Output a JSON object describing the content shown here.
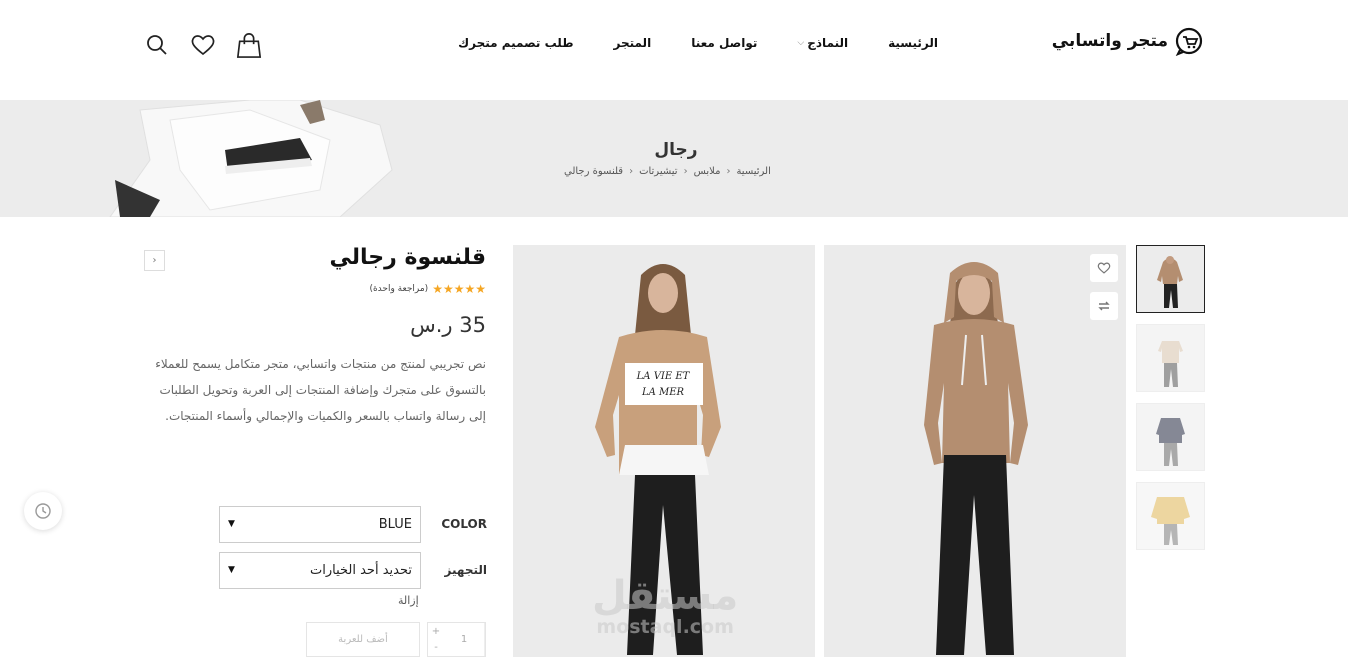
{
  "header": {
    "logo_text": "متجر واتسابي",
    "nav": [
      {
        "label": "الرئيسية"
      },
      {
        "label": "النماذج",
        "has_dropdown": true
      },
      {
        "label": "تواصل معنا"
      },
      {
        "label": "المتجر"
      },
      {
        "label": "طلب تصميم متجرك"
      }
    ],
    "icons": [
      "search-icon",
      "heart-icon",
      "shopping-bag-icon"
    ]
  },
  "banner": {
    "title": "رجال",
    "breadcrumb": [
      "الرئيسية",
      "ملابس",
      "تيشيرتات",
      "قلنسوة رجالي"
    ]
  },
  "product": {
    "title": "قلنسوة رجالي",
    "stars": "★★★★★",
    "reviews": "(مراجعة واحدة)",
    "price": "35 ر.س",
    "description": "نص تجريبي لمنتج من منتجات واتسابي، متجر متكامل يسمح للعملاء بالتسوق على متجرك وإضافة المنتجات إلى العربة وتحويل الطلبات إلى رسالة واتساب بالسعر والكميات والإجمالي وأسماء المنتجات.",
    "options": [
      {
        "label": "COLOR",
        "value": "BLUE"
      },
      {
        "label": "التجهيز",
        "value": "تحديد أحد الخيارات"
      }
    ],
    "clear_label": "إزالة",
    "quantity": "1",
    "qty_plus": "+",
    "qty_minus": "-",
    "add_to_cart": "أضف للعربة",
    "nav_arrow": "›"
  },
  "gallery": {
    "thumbnail_count": 4,
    "active_thumbnail": 1
  },
  "watermark": {
    "arabic": "مستقل",
    "latin": "mostaql.com"
  },
  "colors": {
    "accent_star": "#f5a623",
    "banner_bg": "#ececec",
    "photo_bg": "#ebebeb"
  }
}
